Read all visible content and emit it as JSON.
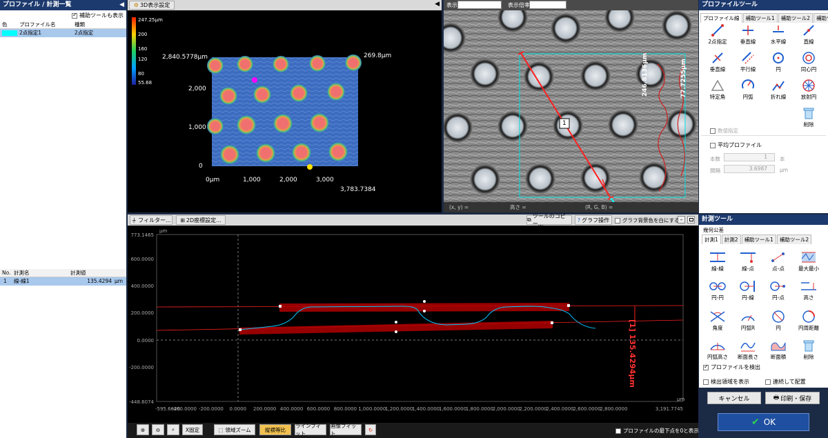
{
  "left": {
    "title": "プロファイル / 計測一覧",
    "show_aux_label": "補助ツールも表示",
    "profile_headers": [
      "色",
      "プロファイル名",
      "種類"
    ],
    "profile_rows": [
      {
        "color": "#00ffff",
        "name": "2点指定1",
        "type": "2点指定"
      }
    ],
    "meas_headers": [
      "No.",
      "計測名",
      "計測値"
    ],
    "meas_rows": [
      {
        "no": "1",
        "name": "線-線1",
        "value": "135.4294",
        "unit": "μm"
      }
    ]
  },
  "view3d": {
    "settings_btn": "3D表示設定",
    "colorbar_labels": [
      "247.25μm",
      "200",
      "160",
      "120",
      "80",
      "55.68"
    ],
    "z_top": "2,840.5778μm",
    "y_ticks": [
      "2,000",
      "1,000",
      "0"
    ],
    "x_ticks": [
      "0μm",
      "1,000",
      "2,000",
      "3,000"
    ],
    "x_end": "3,783.7384",
    "y_end": "269.8μm"
  },
  "view2d": {
    "display_label": "表示",
    "display_value": "テクスチャ",
    "zoom_label": "表示倍率",
    "zoom_value": "自動",
    "marker_label": "1",
    "dim_a": "246.8136μm",
    "dim_b": "77.7255μm",
    "status_xy": "(x, y) =",
    "status_h": "高さ =",
    "status_rgb": "(R, G, B) ="
  },
  "profile_tools": {
    "title": "プロファイルツール",
    "tabs": [
      "プロファイル線",
      "補助ツール1",
      "補助ツール2",
      "補助ツール3"
    ],
    "items": [
      "2点指定",
      "垂直線",
      "水平線",
      "直線",
      "垂直線",
      "平行線",
      "円",
      "同心円",
      "特定角",
      "円弧",
      "折れ線",
      "放射円",
      "削除"
    ],
    "value_spec": "数値指定",
    "avg_profile": "平均プロファイル",
    "count_label": "本数",
    "count_value": "1",
    "count_unit": "本",
    "interval_label": "間隔",
    "interval_value": "3.6987",
    "interval_unit": "μm"
  },
  "graph": {
    "filter_btn": "フィルター...",
    "coord_btn": "2D座標設定...",
    "copy_btn": "ツールのコピー...",
    "graph_op_btn": "グラフ操作",
    "bg_white": "グラフ背景色を白にする",
    "y_unit": "μm",
    "x_unit": "μm",
    "y_top": "773.1465",
    "y_bottom": "-448.6074",
    "y_ticks": [
      "600.0000",
      "400.0000",
      "200.0000",
      "0.0000",
      "-200.0000",
      "-400.0000"
    ],
    "x_start": "-595.6626",
    "x_ticks": [
      "-400.0000",
      "-200.0000",
      "0.0000",
      "200.0000",
      "400.0000",
      "600.0000",
      "800.0000",
      "1,000.0000",
      "1,200.0000",
      "1,400.0000",
      "1,600.0000",
      "1,800.0000",
      "2,000.0000",
      "2,200.0000",
      "2,400.0000",
      "2,600.0000",
      "2,800.0000"
    ],
    "x_end": "3,191.7745",
    "meas_label": "[1] 135.4294μm"
  },
  "bottom_bar": {
    "x_fix": "X固定",
    "area_zoom": "領域ズーム",
    "aspect": "縦横等比",
    "line_fit": "ラインフィット",
    "image_fit": "画像フィット",
    "show_bottom": "プロファイルの最下点を0と表示する"
  },
  "meas_tools": {
    "title": "計測ツール",
    "group": "幾何公差",
    "tabs": [
      "計測1",
      "計測2",
      "補助ツール1",
      "補助ツール2"
    ],
    "items": [
      "線-線",
      "線-点",
      "点-点",
      "最大最小",
      "円-円",
      "円-線",
      "円-点",
      "高さ",
      "角度",
      "円弧R",
      "円",
      "円周距離",
      "円弧高さ",
      "断面長さ",
      "断面積",
      "削除"
    ],
    "detect_profile": "プロファイルを検出",
    "show_region": "検出領域を表示",
    "continuous": "連続して配置",
    "cancel": "キャンセル",
    "print_save": "印刷・保存",
    "ok": "OK"
  },
  "colors": {
    "accent": "#1d3a6e",
    "ok_bg": "#1f4fa0",
    "profile": "#00ffff",
    "measure": "#ff0000"
  }
}
